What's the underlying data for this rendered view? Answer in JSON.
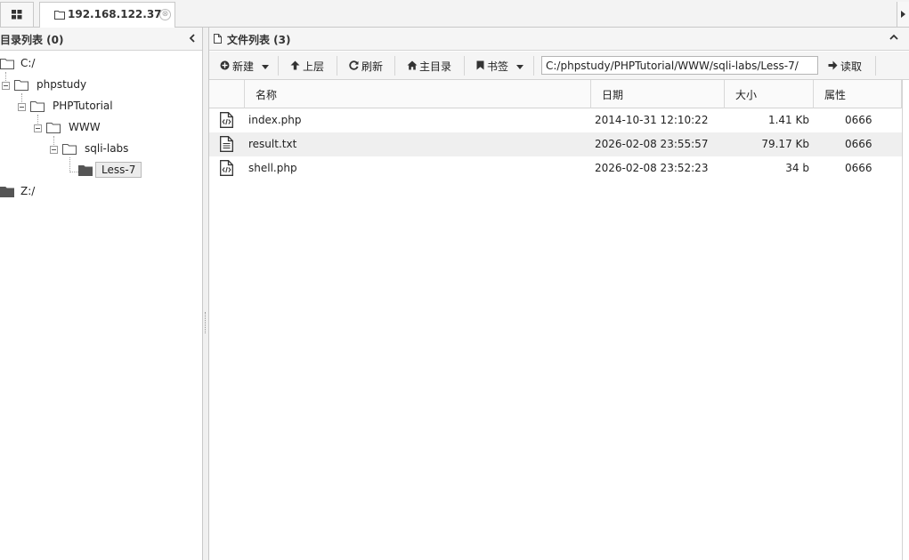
{
  "tabs": {
    "grid_icon": "grid-icon",
    "host_label": "192.168.122.37",
    "close_glyph": "⊗"
  },
  "dir_panel": {
    "title": "目录列表 (0)",
    "tree": [
      {
        "label": "C:/",
        "icon": "folder-outline-icon"
      },
      {
        "label": "phpstudy",
        "icon": "folder-outline-icon"
      },
      {
        "label": "PHPTutorial",
        "icon": "folder-outline-icon"
      },
      {
        "label": "WWW",
        "icon": "folder-outline-icon"
      },
      {
        "label": "sqli-labs",
        "icon": "folder-outline-icon"
      },
      {
        "label": "Less-7",
        "icon": "folder-filled-icon",
        "selected": true
      },
      {
        "label": "Z:/",
        "icon": "folder-filled-icon"
      }
    ]
  },
  "file_panel": {
    "title": "文件列表 (3)",
    "toolbar": {
      "new_label": "新建",
      "up_label": "上层",
      "refresh_label": "刷新",
      "home_label": "主目录",
      "bookmark_label": "书签",
      "path_value": "C:/phpstudy/PHPTutorial/WWW/sqli-labs/Less-7/",
      "read_label": "读取"
    },
    "columns": {
      "name": "名称",
      "date": "日期",
      "size": "大小",
      "attr": "属性"
    },
    "files": [
      {
        "name": "index.php",
        "date": "2014-10-31 12:10:22",
        "size": "1.41 Kb",
        "attr": "0666",
        "icon": "code-file-icon"
      },
      {
        "name": "result.txt",
        "date": "2026-02-08 23:55:57",
        "size": "79.17 Kb",
        "attr": "0666",
        "icon": "text-file-icon"
      },
      {
        "name": "shell.php",
        "date": "2026-02-08 23:52:23",
        "size": "34 b",
        "attr": "0666",
        "icon": "code-file-icon"
      }
    ]
  },
  "colors": {
    "border": "#c8c8c8",
    "header_bg": "#f5f5f5",
    "row_alt": "#efefef",
    "folder_fill": "#555555"
  }
}
